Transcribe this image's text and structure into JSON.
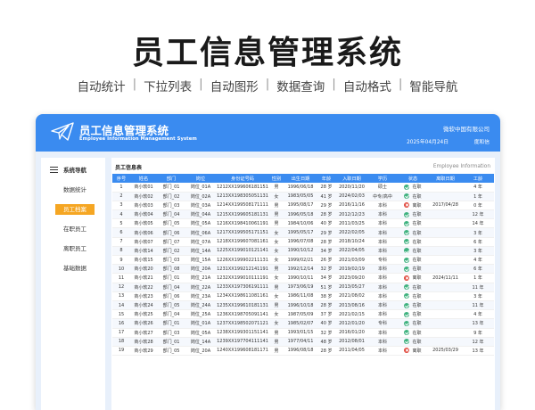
{
  "hero": {
    "title": "员工信息管理系统",
    "features": [
      "自动统计",
      "下拉列表",
      "自动图形",
      "数据查询",
      "自动格式",
      "智能导航"
    ],
    "separator": "|"
  },
  "app": {
    "title": "员工信息管理系统",
    "subtitle": "Employee Information Management System",
    "company": "微软中国有限公司",
    "date": "2025年04月24日",
    "maker": "度和信",
    "logo_icon": "paper-plane-icon",
    "header_color": "#3a8bf0"
  },
  "sidebar": {
    "heading": "系统导航",
    "heading_icon": "menu-icon",
    "items": [
      {
        "label": "数据统计",
        "active": false
      },
      {
        "label": "员工档案",
        "active": true
      },
      {
        "label": "在职员工",
        "active": false
      },
      {
        "label": "离职员工",
        "active": false
      },
      {
        "label": "基础数据",
        "active": false
      }
    ],
    "active_color": "#f5a623"
  },
  "table": {
    "title": "员工信息表",
    "title_en": "Employee Information",
    "columns": [
      "序号",
      "姓名",
      "部门",
      "岗位",
      "身份证号码",
      "性别",
      "出生日期",
      "年龄",
      "入职日期",
      "学历",
      "状态",
      "离职日期",
      "工龄"
    ],
    "rows": [
      [
        "1",
        "商小软01",
        "部门_01",
        "岗位_01A",
        "1212XX19960618115​1",
        "男",
        "1996/06/18",
        "28 岁",
        "2020/11/20",
        "硕士",
        "在职",
        "",
        "4 年"
      ],
      [
        "2",
        "商小软02",
        "部门_02",
        "岗位_02A",
        "1213XX198305051131",
        "女",
        "1983/05/05",
        "41 岁",
        "2024/02/03",
        "中专/高中",
        "在职",
        "",
        "1 年"
      ],
      [
        "3",
        "商小软03",
        "部门_03",
        "岗位_03A",
        "1214XX199508171111",
        "男",
        "1995/08/17",
        "29 岁",
        "2016/11/16",
        "本科",
        "离职",
        "2017/04/28",
        "0 年"
      ],
      [
        "4",
        "商小软04",
        "部门_04",
        "岗位_04A",
        "1215XX199605181131",
        "男",
        "1996/05/18",
        "28 岁",
        "2012/12/23",
        "本科",
        "在职",
        "",
        "12 年"
      ],
      [
        "5",
        "商小软05",
        "部门_05",
        "岗位_05A",
        "1216XX198410061191",
        "男",
        "1984/10/06",
        "40 岁",
        "2011/03/25",
        "本科",
        "在职",
        "",
        "14 年"
      ],
      [
        "6",
        "商小软06",
        "部门_06",
        "岗位_06A",
        "1217XX199505171151",
        "女",
        "1995/05/17",
        "29 岁",
        "2022/02/05",
        "本科",
        "在职",
        "",
        "3 年"
      ],
      [
        "7",
        "商小软07",
        "部门_07",
        "岗位_07A",
        "1218XX199607081161",
        "女",
        "1996/07/08",
        "28 岁",
        "2018/10/24",
        "本科",
        "在职",
        "",
        "6 年"
      ],
      [
        "8",
        "商小软14",
        "部门_02",
        "岗位_14A",
        "1225XX199010121141",
        "女",
        "1990/10/12",
        "34 岁",
        "2022/04/05",
        "本科",
        "在职",
        "",
        "3 年"
      ],
      [
        "9",
        "商小软15",
        "部门_03",
        "岗位_15A",
        "1226XX199902211131",
        "女",
        "1999/02/21",
        "26 岁",
        "2021/03/09",
        "专科",
        "在职",
        "",
        "4 年"
      ],
      [
        "10",
        "商小软20",
        "部门_08",
        "岗位_20A",
        "1231XX199212141191",
        "男",
        "1992/12/14",
        "32 岁",
        "2019/02/19",
        "本科",
        "在职",
        "",
        "6 年"
      ],
      [
        "11",
        "商小软21",
        "部门_01",
        "岗位_21A",
        "1232XX199010111191",
        "女",
        "1990/10/11",
        "34 岁",
        "2023/09/20",
        "本科",
        "离职",
        "2024/11/11",
        "1 年"
      ],
      [
        "12",
        "商小软22",
        "部门_04",
        "岗位_22A",
        "1233XX197306191111",
        "男",
        "1973/06/19",
        "51 岁",
        "2013/05/27",
        "本科",
        "在职",
        "",
        "11 年"
      ],
      [
        "13",
        "商小软23",
        "部门_06",
        "岗位_23A",
        "1234XX198611081161",
        "女",
        "1986/11/08",
        "38 岁",
        "2021/08/02",
        "本科",
        "在职",
        "",
        "3 年"
      ],
      [
        "14",
        "商小软24",
        "部门_05",
        "岗位_24A",
        "1235XX199610181131",
        "男",
        "1996/10/18",
        "28 岁",
        "2013/08/16",
        "本科",
        "在职",
        "",
        "11 年"
      ],
      [
        "15",
        "商小软25",
        "部门_04",
        "岗位_25A",
        "1236XX198705091141",
        "女",
        "1987/05/09",
        "37 岁",
        "2021/02/15",
        "本科",
        "在职",
        "",
        "4 年"
      ],
      [
        "16",
        "商小软26",
        "部门_01",
        "岗位_01A",
        "1237XX198502071121",
        "女",
        "1985/02/07",
        "40 岁",
        "2012/01/20",
        "专科",
        "在职",
        "",
        "13 年"
      ],
      [
        "17",
        "商小软27",
        "部门_03",
        "岗位_05A",
        "1238XX199301151141",
        "男",
        "1993/01/15",
        "32 岁",
        "2016/01/20",
        "本科",
        "在职",
        "",
        "9 年"
      ],
      [
        "18",
        "商小软28",
        "部门_01",
        "岗位_14A",
        "1239XX197704111141",
        "男",
        "1977/04/11",
        "48 岁",
        "2012/08/01",
        "本科",
        "在职",
        "",
        "12 年"
      ],
      [
        "19",
        "商小软29",
        "部门_05",
        "岗位_20A",
        "1240XX199608181171",
        "男",
        "1996/08/18",
        "28 岁",
        "2011/04/05",
        "本科",
        "离职",
        "2025/03/29",
        "13 年"
      ]
    ],
    "status_icons": {
      "在职": "check-circle-icon",
      "离职": "x-circle-icon"
    },
    "status_colors": {
      "在职": "#3fb27f",
      "离职": "#e0473c"
    }
  }
}
